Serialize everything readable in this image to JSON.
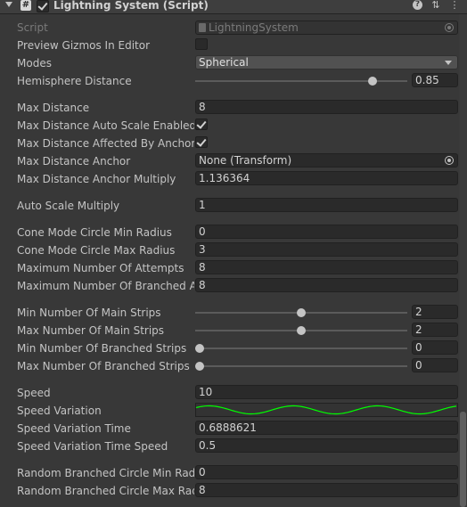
{
  "header": {
    "title": "Lightning System (Script)",
    "icon_names": [
      "fold-arrow-icon",
      "script-icon",
      "enabled-checkbox",
      "help-icon",
      "preset-icon",
      "more-options-icon"
    ]
  },
  "props": {
    "script": {
      "label": "Script",
      "value": "LightningSystem"
    },
    "preview_gizmos": {
      "label": "Preview Gizmos In Editor",
      "checked": false
    },
    "modes": {
      "label": "Modes",
      "value": "Spherical"
    },
    "hemisphere_distance": {
      "label": "Hemisphere Distance",
      "value": "0.85",
      "fraction": 0.85
    },
    "max_distance": {
      "label": "Max Distance",
      "value": "8"
    },
    "max_distance_auto_scale": {
      "label": "Max Distance Auto Scale Enabled",
      "checked": true
    },
    "max_distance_affected_by_anchor": {
      "label": "Max Distance Affected By Anchor",
      "checked": true
    },
    "max_distance_anchor": {
      "label": "Max Distance Anchor",
      "value": "None (Transform)"
    },
    "max_distance_anchor_multiply": {
      "label": "Max Distance Anchor Multiply",
      "value": "1.136364"
    },
    "auto_scale_multiply": {
      "label": "Auto Scale Multiply",
      "value": "1"
    },
    "cone_min_radius": {
      "label": "Cone Mode Circle Min Radius",
      "value": "0"
    },
    "cone_max_radius": {
      "label": "Cone Mode Circle Max Radius",
      "value": "3"
    },
    "max_attempts": {
      "label": "Maximum Number Of Attempts",
      "value": "8"
    },
    "max_branched_attempts": {
      "label": "Maximum Number Of Branched Attempts",
      "value": "8"
    },
    "min_main_strips": {
      "label": "Min Number Of Main Strips",
      "value": "2",
      "fraction": 0.5
    },
    "max_main_strips": {
      "label": "Max Number Of Main Strips",
      "value": "2",
      "fraction": 0.5
    },
    "min_branched_strips": {
      "label": "Min Number Of Branched Strips",
      "value": "0",
      "fraction": 0
    },
    "max_branched_strips": {
      "label": "Max Number Of Branched Strips",
      "value": "0",
      "fraction": 0
    },
    "speed": {
      "label": "Speed",
      "value": "10"
    },
    "speed_variation": {
      "label": "Speed Variation",
      "curve_color": "#00ff00"
    },
    "speed_variation_time": {
      "label": "Speed Variation Time",
      "value": "0.6888621"
    },
    "speed_variation_time_speed": {
      "label": "Speed Variation Time Speed",
      "value": "0.5"
    },
    "random_branched_min_radius": {
      "label": "Random Branched Circle Min Radius",
      "value": "0"
    },
    "random_branched_max_radius": {
      "label": "Random Branched Circle Max Radius",
      "value": "8"
    }
  }
}
